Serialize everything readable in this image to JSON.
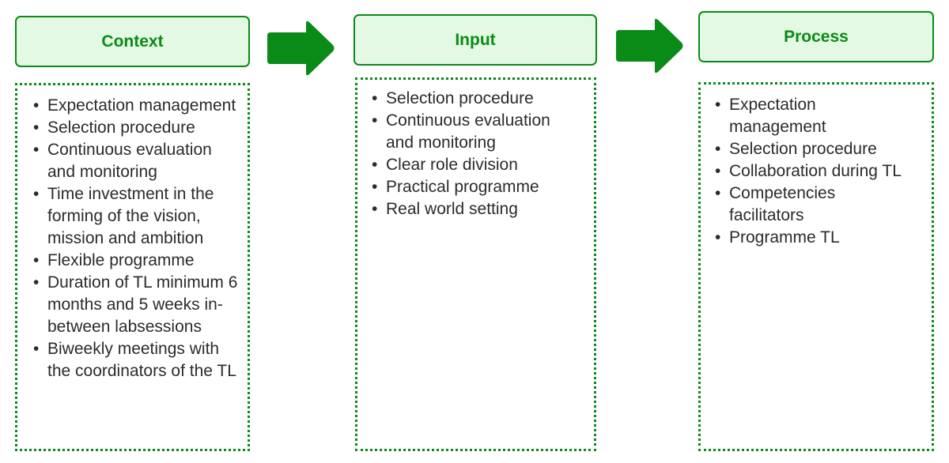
{
  "colors": {
    "accent": "#0a8a16",
    "header_fill": "#e3f9e3",
    "text": "#2b2b2b"
  },
  "columns": [
    {
      "title": "Context",
      "items": [
        "Expectation management",
        "Selection procedure",
        "Continuous evaluation and monitoring",
        "Time investment in the forming of the vision, mission and ambition",
        "Flexible programme",
        "Duration of TL minimum 6 months and 5 weeks in-between labsessions",
        "Biweekly meetings with the coordinators of the TL"
      ]
    },
    {
      "title": "Input",
      "items": [
        "Selection procedure",
        "Continuous evaluation and monitoring",
        "Clear role division",
        "Practical programme",
        "Real world setting"
      ]
    },
    {
      "title": "Process",
      "items": [
        "Expectation management",
        "Selection procedure",
        "Collaboration during TL",
        "Competencies facilitators",
        "Programme TL"
      ]
    }
  ],
  "arrows": [
    "arrow-right-icon",
    "arrow-right-icon"
  ]
}
